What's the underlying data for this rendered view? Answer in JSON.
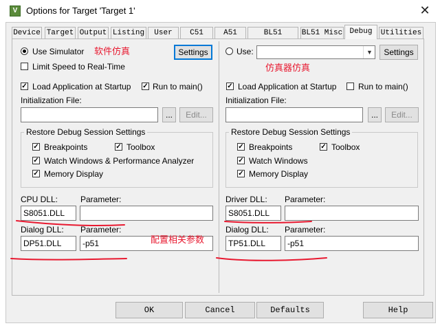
{
  "window": {
    "title": "Options for Target 'Target 1'",
    "icon_name": "keil-app-icon"
  },
  "tabs": [
    {
      "label": "Device"
    },
    {
      "label": "Target"
    },
    {
      "label": "Output"
    },
    {
      "label": "Listing"
    },
    {
      "label": "User"
    },
    {
      "label": "C51"
    },
    {
      "label": "A51"
    },
    {
      "label": "BL51 Locate"
    },
    {
      "label": "BL51 Misc"
    },
    {
      "label": "Debug",
      "active": true
    },
    {
      "label": "Utilities"
    }
  ],
  "left": {
    "use_simulator": "Use Simulator",
    "settings": "Settings",
    "limit_speed": "Limit Speed to Real-Time",
    "load_app": "Load Application at Startup",
    "run_to_main": "Run to main()",
    "init_file_label": "Initialization File:",
    "browse": "...",
    "edit": "Edit...",
    "restore_title": "Restore Debug Session Settings",
    "breakpoints": "Breakpoints",
    "toolbox": "Toolbox",
    "watch": "Watch Windows & Performance Analyzer",
    "memory": "Memory Display",
    "cpu_dll_label": "CPU DLL:",
    "cpu_dll_value": "S8051.DLL",
    "parameter_label": "Parameter:",
    "cpu_param_value": "",
    "dialog_dll_label": "Dialog DLL:",
    "dialog_dll_value": "DP51.DLL",
    "dialog_param_value": "-p51"
  },
  "right": {
    "use": "Use:",
    "use_select_value": "",
    "settings": "Settings",
    "load_app": "Load Application at Startup",
    "run_to_main": "Run to main()",
    "init_file_label": "Initialization File:",
    "browse": "...",
    "edit": "Edit...",
    "restore_title": "Restore Debug Session Settings",
    "breakpoints": "Breakpoints",
    "toolbox": "Toolbox",
    "watch": "Watch Windows",
    "memory": "Memory Display",
    "driver_dll_label": "Driver DLL:",
    "driver_dll_value": "S8051.DLL",
    "parameter_label": "Parameter:",
    "driver_param_value": "",
    "dialog_dll_label": "Dialog DLL:",
    "dialog_dll_value": "TP51.DLL",
    "dialog_param_value": "-p51"
  },
  "annotations": {
    "software_sim": "软件仿真",
    "hardware_sim": "仿真器仿真",
    "config_params": "配置相关参数",
    "color": "#e8182f"
  },
  "footer": {
    "ok": "OK",
    "cancel": "Cancel",
    "defaults": "Defaults",
    "help": "Help"
  }
}
